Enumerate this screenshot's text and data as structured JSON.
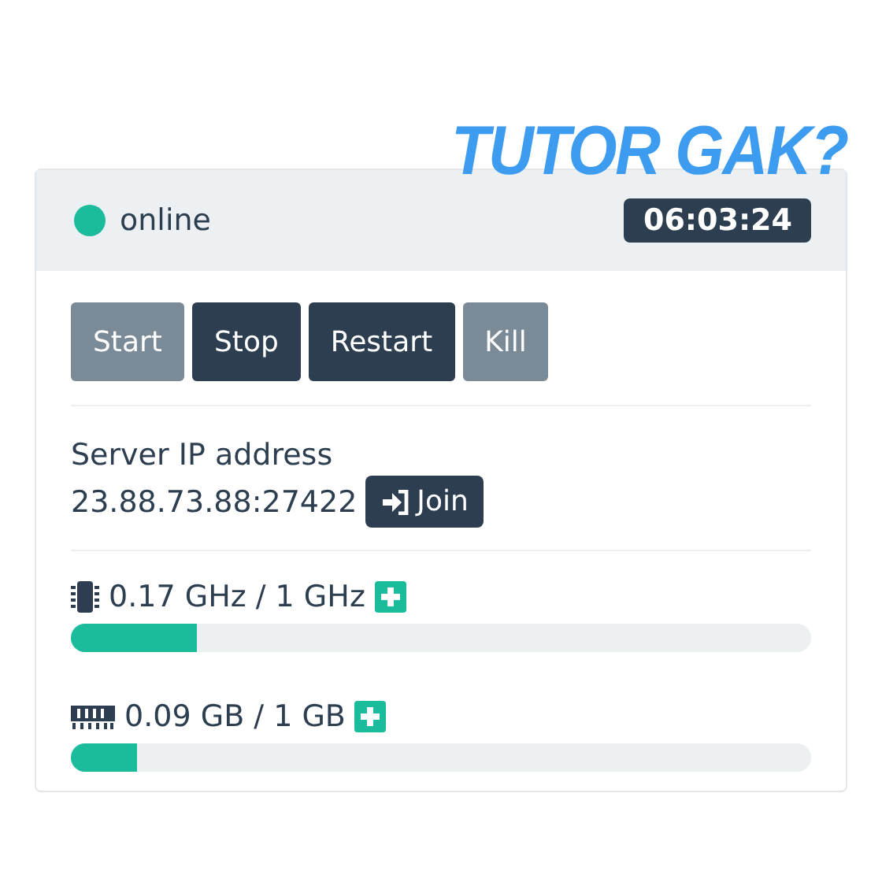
{
  "caption": "TUTOR GAK?",
  "status": {
    "label": "online",
    "color": "#1abc9c"
  },
  "uptime": "06:03:24",
  "buttons": [
    {
      "label": "Start",
      "disabled": true
    },
    {
      "label": "Stop",
      "disabled": false
    },
    {
      "label": "Restart",
      "disabled": false
    },
    {
      "label": "Kill",
      "disabled": true
    }
  ],
  "server": {
    "label": "Server IP address",
    "address": "23.88.73.88:27422",
    "join": "Join"
  },
  "resources": [
    {
      "kind": "cpu",
      "reading": "0.17 GHz / 1 GHz",
      "level": 0.17
    },
    {
      "kind": "memory",
      "reading": "0.09 GB / 1 GB",
      "level": 0.09
    }
  ]
}
